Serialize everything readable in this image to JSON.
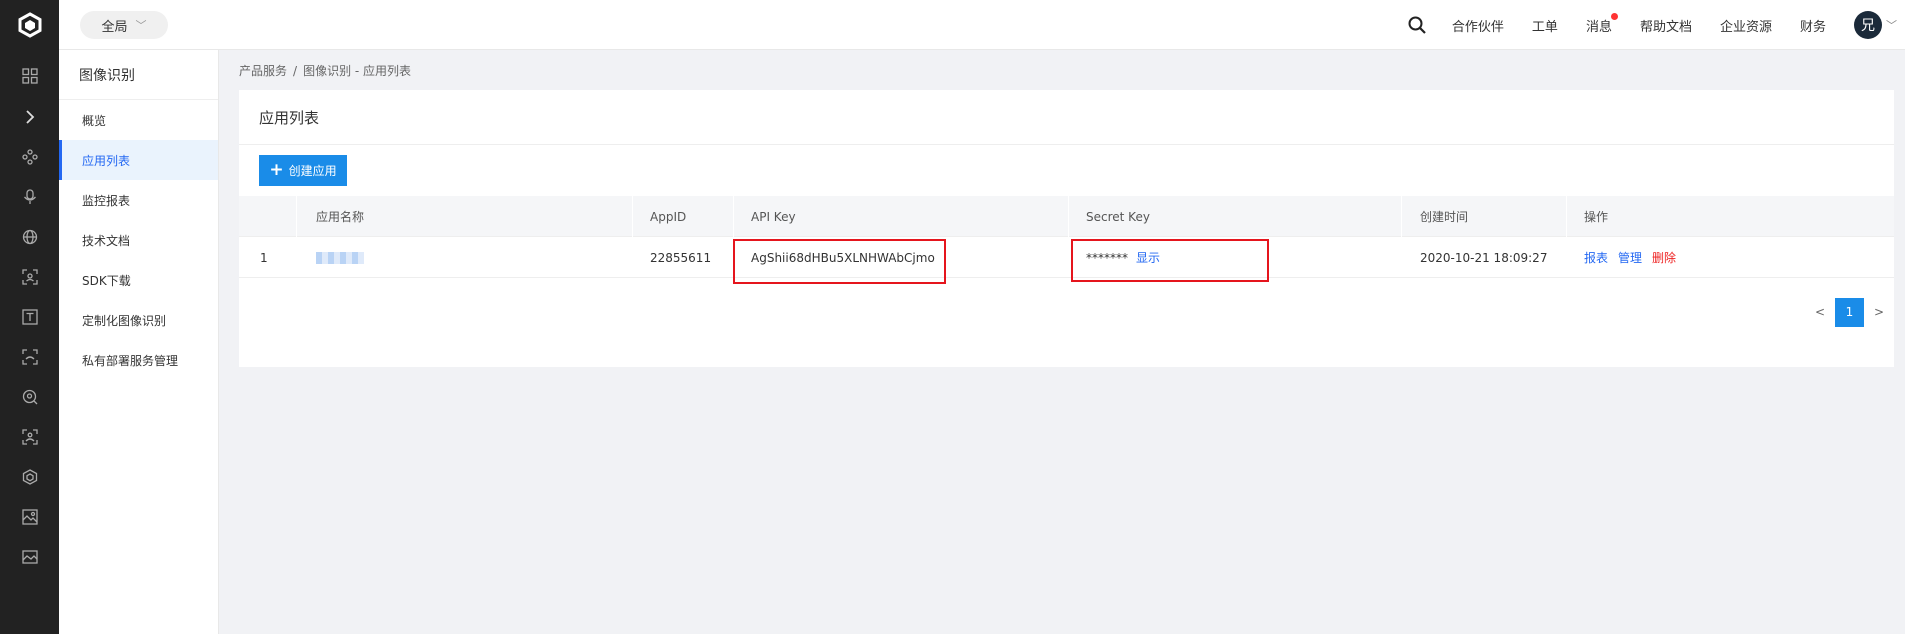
{
  "topbar": {
    "scope_label": "全局",
    "nav": [
      "合作伙伴",
      "工单",
      "消息",
      "帮助文档",
      "企业资源",
      "财务"
    ],
    "avatar_text": "兄",
    "notification_color": "#ff3333"
  },
  "rail": {
    "icons": [
      "grid-icon",
      "expand-icon",
      "network-icon",
      "microphone-icon",
      "globe-icon",
      "scan-icon",
      "text-icon",
      "face-icon",
      "search-face-icon",
      "body-icon",
      "cube-icon",
      "image-recognition-icon",
      "image-icon"
    ]
  },
  "subnav": {
    "title": "图像识别",
    "items": [
      "概览",
      "应用列表",
      "监控报表",
      "技术文档",
      "SDK下载",
      "定制化图像识别",
      "私有部署服务管理"
    ],
    "active_index": 1
  },
  "breadcrumb": {
    "root": "产品服务",
    "separator": "/",
    "current": "图像识别 - 应用列表"
  },
  "panel": {
    "title": "应用列表",
    "create_button": "创建应用"
  },
  "table": {
    "headers": [
      "应用名称",
      "AppID",
      "API Key",
      "Secret Key",
      "创建时间",
      "操作"
    ],
    "rows": [
      {
        "index": "1",
        "app_id": "22855611",
        "api_key": "AgShii68dHBu5XLNHWAbCjmo",
        "secret_key_masked": "*******",
        "secret_show": "显示",
        "created_at": "2020-10-21 18:09:27",
        "actions": [
          "报表",
          "管理",
          "删除"
        ]
      }
    ]
  },
  "pagination": {
    "prev": "<",
    "current_page": "1",
    "next": ">"
  },
  "colors": {
    "accent": "#1a8ce8",
    "highlight_box": "#e5151d",
    "danger": "#ee2222"
  }
}
